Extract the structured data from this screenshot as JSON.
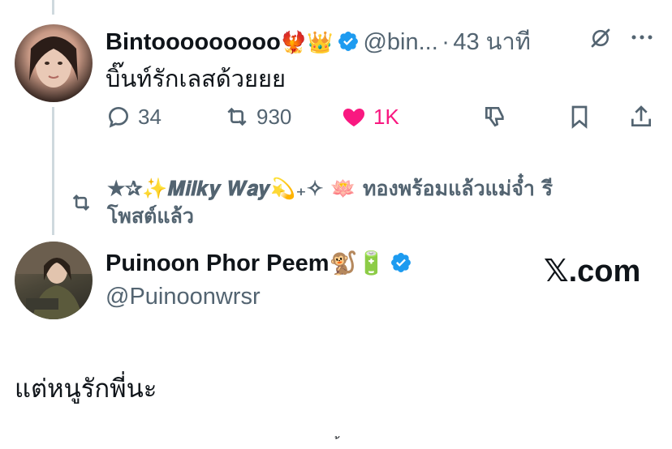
{
  "tweet1": {
    "name": "Bintooooooooo",
    "emoji": "🐦‍🔥👑",
    "handle": "@bin...",
    "separator": "·",
    "time": "43 นาที",
    "text": "บิ๊นท์รักเลสด้วยยย",
    "actions": {
      "reply_count": "34",
      "retweet_count": "930",
      "like_count": "1K"
    },
    "like_color": "#f91880"
  },
  "retweet_banner": {
    "line1": "★✰✨𝑴𝒊𝒍𝒌𝒚 𝑾𝒂𝒚💫₊✧ 🪷 ทองพร้อมแล้วแม่จ๋ำ รี",
    "line2": "โพสต์แล้ว"
  },
  "tweet2": {
    "name": "Puinoon Phor Peem",
    "emoji": "🐒🔋",
    "handle": "@Puinoonwrsr",
    "text": "แต่หนูรักพี่นะ",
    "watermark": "𝕏.com"
  },
  "accent_color": "#1d9bf0"
}
